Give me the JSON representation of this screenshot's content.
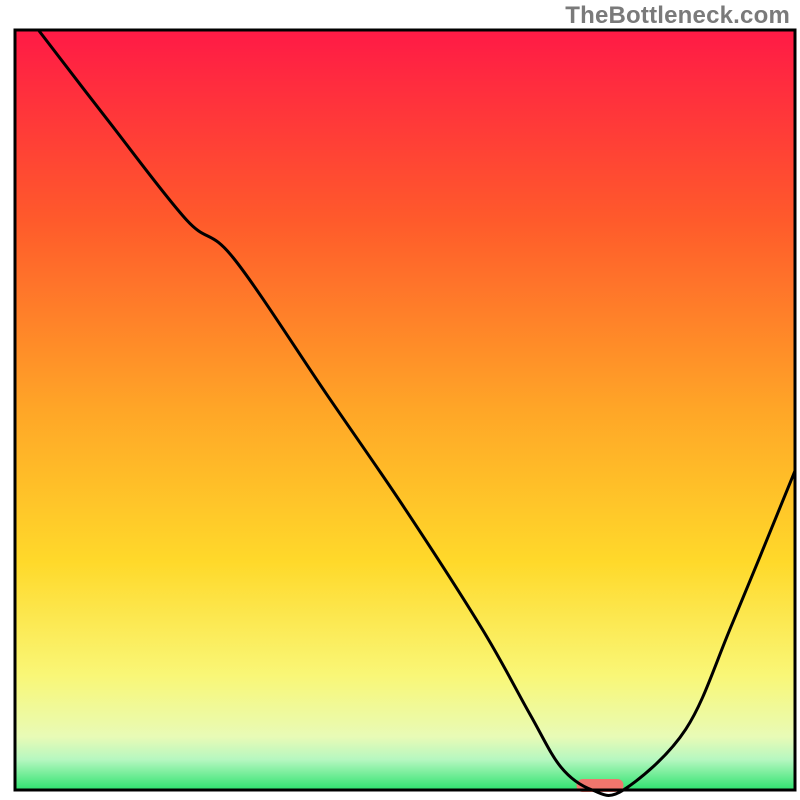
{
  "watermark": "TheBottleneck.com",
  "chart_data": {
    "type": "line",
    "title": "",
    "xlabel": "",
    "ylabel": "",
    "xlim": [
      0,
      100
    ],
    "ylim": [
      0,
      100
    ],
    "grid": false,
    "legend": false,
    "gradient_stops": [
      {
        "offset": 0,
        "color": "#ff1a46"
      },
      {
        "offset": 25,
        "color": "#ff5a2b"
      },
      {
        "offset": 50,
        "color": "#ffa627"
      },
      {
        "offset": 70,
        "color": "#ffd92a"
      },
      {
        "offset": 85,
        "color": "#f9f777"
      },
      {
        "offset": 93,
        "color": "#e8fbb6"
      },
      {
        "offset": 96,
        "color": "#b6f7c0"
      },
      {
        "offset": 100,
        "color": "#2ee36f"
      }
    ],
    "series": [
      {
        "name": "bottleneck-curve",
        "x": [
          3,
          12,
          22,
          28,
          40,
          50,
          60,
          66,
          70,
          74,
          78,
          86,
          92,
          100
        ],
        "y": [
          100,
          88,
          75,
          70,
          52,
          37,
          21,
          10,
          3,
          0,
          0,
          8,
          22,
          42
        ]
      }
    ],
    "marker": {
      "name": "optimal-zone-marker",
      "x": 75,
      "y": 0,
      "width_pct": 6,
      "color": "#f0766d"
    },
    "border": {
      "color": "#000000",
      "width": 3
    }
  }
}
